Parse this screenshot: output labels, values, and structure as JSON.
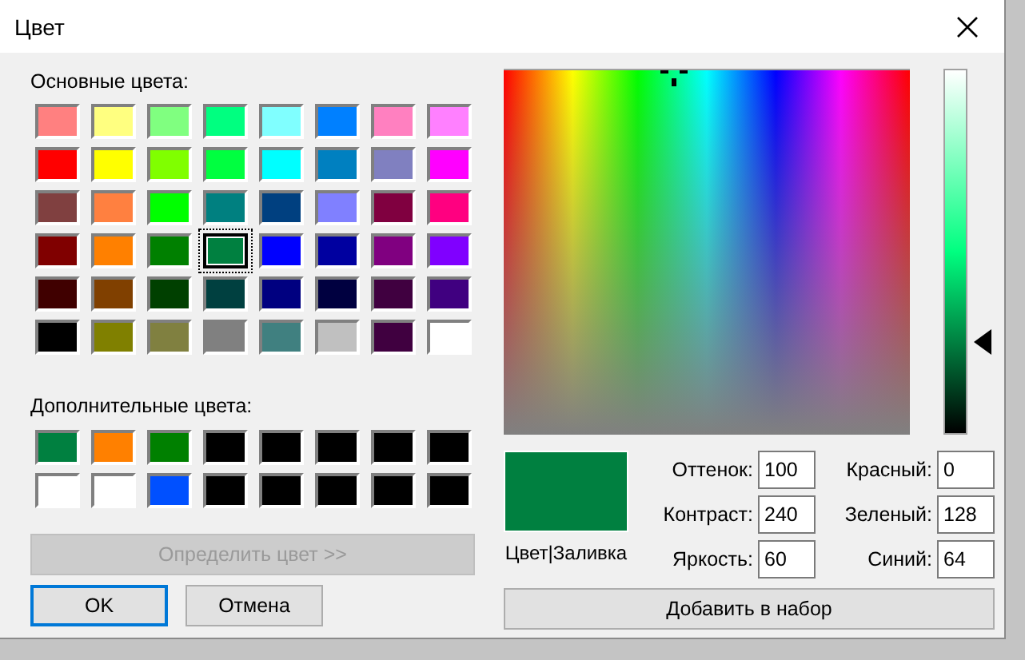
{
  "window": {
    "title": "Цвет"
  },
  "basic_colors": {
    "label": "Основные цвета:",
    "swatches": [
      {
        "color": "#ff8080",
        "selected": false
      },
      {
        "color": "#ffff80",
        "selected": false
      },
      {
        "color": "#80ff80",
        "selected": false
      },
      {
        "color": "#00ff80",
        "selected": false
      },
      {
        "color": "#80ffff",
        "selected": false
      },
      {
        "color": "#0080ff",
        "selected": false
      },
      {
        "color": "#ff80c0",
        "selected": false
      },
      {
        "color": "#ff80ff",
        "selected": false
      },
      {
        "color": "#ff0000",
        "selected": false
      },
      {
        "color": "#ffff00",
        "selected": false
      },
      {
        "color": "#80ff00",
        "selected": false
      },
      {
        "color": "#00ff40",
        "selected": false
      },
      {
        "color": "#00ffff",
        "selected": false
      },
      {
        "color": "#0080c0",
        "selected": false
      },
      {
        "color": "#8080c0",
        "selected": false
      },
      {
        "color": "#ff00ff",
        "selected": false
      },
      {
        "color": "#804040",
        "selected": false
      },
      {
        "color": "#ff8040",
        "selected": false
      },
      {
        "color": "#00ff00",
        "selected": false
      },
      {
        "color": "#008080",
        "selected": false
      },
      {
        "color": "#004080",
        "selected": false
      },
      {
        "color": "#8080ff",
        "selected": false
      },
      {
        "color": "#800040",
        "selected": false
      },
      {
        "color": "#ff0080",
        "selected": false
      },
      {
        "color": "#800000",
        "selected": false
      },
      {
        "color": "#ff8000",
        "selected": false
      },
      {
        "color": "#008000",
        "selected": false
      },
      {
        "color": "#008040",
        "selected": true
      },
      {
        "color": "#0000ff",
        "selected": false
      },
      {
        "color": "#0000a0",
        "selected": false
      },
      {
        "color": "#800080",
        "selected": false
      },
      {
        "color": "#8000ff",
        "selected": false
      },
      {
        "color": "#400000",
        "selected": false
      },
      {
        "color": "#804000",
        "selected": false
      },
      {
        "color": "#004000",
        "selected": false
      },
      {
        "color": "#004040",
        "selected": false
      },
      {
        "color": "#000080",
        "selected": false
      },
      {
        "color": "#000040",
        "selected": false
      },
      {
        "color": "#400040",
        "selected": false
      },
      {
        "color": "#400080",
        "selected": false
      },
      {
        "color": "#000000",
        "selected": false
      },
      {
        "color": "#808000",
        "selected": false
      },
      {
        "color": "#808040",
        "selected": false
      },
      {
        "color": "#808080",
        "selected": false
      },
      {
        "color": "#408080",
        "selected": false
      },
      {
        "color": "#c0c0c0",
        "selected": false
      },
      {
        "color": "#400040",
        "selected": false
      },
      {
        "color": "#ffffff",
        "selected": false
      }
    ]
  },
  "custom_colors": {
    "label": "Дополнительные цвета:",
    "swatches": [
      {
        "color": "#008040"
      },
      {
        "color": "#ff8000"
      },
      {
        "color": "#008000"
      },
      {
        "color": "#000000"
      },
      {
        "color": "#000000"
      },
      {
        "color": "#000000"
      },
      {
        "color": "#000000"
      },
      {
        "color": "#000000"
      },
      {
        "color": "#ffffff"
      },
      {
        "color": "#ffffff"
      },
      {
        "color": "#0050ff"
      },
      {
        "color": "#000000"
      },
      {
        "color": "#000000"
      },
      {
        "color": "#000000"
      },
      {
        "color": "#000000"
      },
      {
        "color": "#000000"
      }
    ]
  },
  "define_button": {
    "label": "Определить цвет >>",
    "disabled": true
  },
  "buttons": [
    {
      "label": "OK",
      "default": true
    },
    {
      "label": "Отмена",
      "default": false
    }
  ],
  "luminance_slider": {
    "level": 0.25
  },
  "preview": {
    "color": "#008040",
    "label": "Цвет|Заливка"
  },
  "fields": [
    {
      "label": "Оттенок:",
      "value": "100"
    },
    {
      "label": "Красный:",
      "value": "0"
    },
    {
      "label": "Контраст:",
      "value": "240"
    },
    {
      "label": "Зеленый:",
      "value": "128"
    },
    {
      "label": "Яркость:",
      "value": "60"
    },
    {
      "label": "Синий:",
      "value": "64"
    }
  ],
  "add_button": {
    "label": "Добавить в набор"
  }
}
